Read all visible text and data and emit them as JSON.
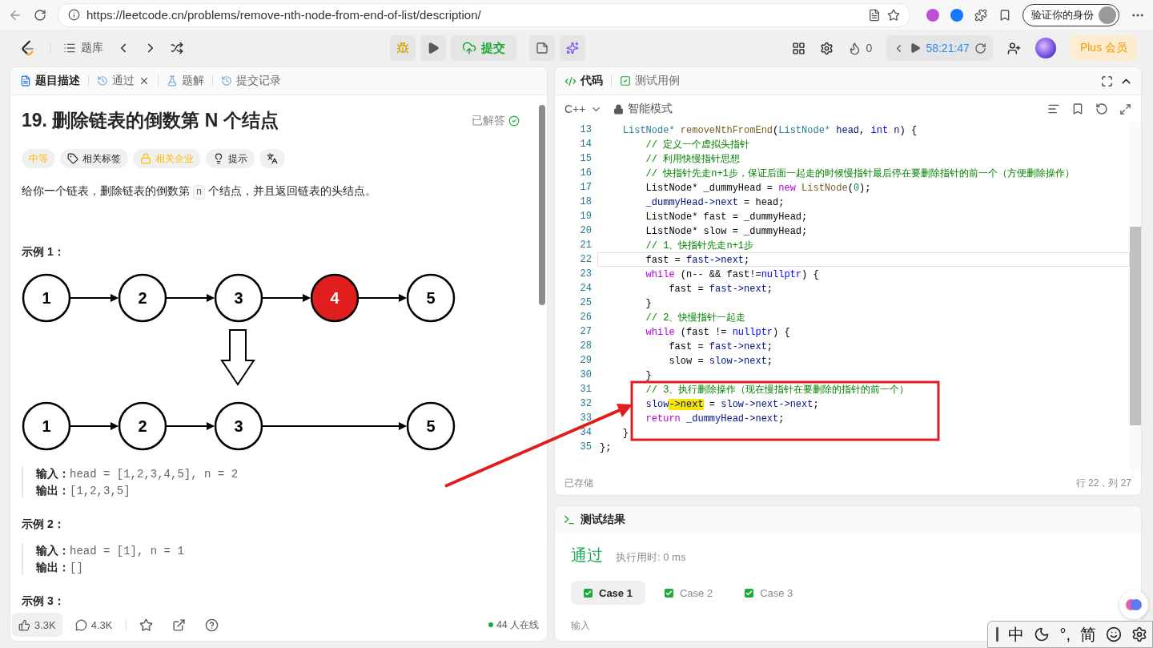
{
  "browser": {
    "url": "https://leetcode.cn/problems/remove-nth-node-from-end-of-list/description/",
    "profile_label": "验证你的身份"
  },
  "toolbar": {
    "problem_list": "题库",
    "submit": "提交",
    "streak": "0",
    "timer": "58:21:47",
    "plus": "Plus 会员"
  },
  "left_tabs": [
    {
      "label": "题目描述",
      "selected": true,
      "closable": false
    },
    {
      "label": "通过",
      "selected": false,
      "closable": true
    },
    {
      "label": "题解",
      "selected": false,
      "closable": false
    },
    {
      "label": "提交记录",
      "selected": false,
      "closable": false
    }
  ],
  "problem": {
    "title": "19. 删除链表的倒数第 N 个结点",
    "status": "已解答",
    "tags": [
      {
        "label": "中等",
        "kind": "difficulty"
      },
      {
        "label": "相关标签",
        "kind": "tag"
      },
      {
        "label": "相关企业",
        "kind": "company"
      },
      {
        "label": "提示",
        "kind": "hint"
      }
    ],
    "description": {
      "before": "给你一个链表，删除链表的倒数第 ",
      "code": "n",
      "after": " 个结点，并且返回链表的头结点。"
    },
    "examples": [
      {
        "title": "示例 1：",
        "diagram": {
          "before": [
            {
              "label": "1",
              "removed": false
            },
            {
              "label": "2",
              "removed": false
            },
            {
              "label": "3",
              "removed": false
            },
            {
              "label": "4",
              "removed": true
            },
            {
              "label": "5",
              "removed": false
            }
          ],
          "after": [
            {
              "label": "1"
            },
            {
              "label": "2"
            },
            {
              "label": "3"
            },
            {
              "label": "5"
            }
          ]
        },
        "lines": [
          {
            "label": "输入：",
            "value": "head = [1,2,3,4,5], n = 2"
          },
          {
            "label": "输出：",
            "value": "[1,2,3,5]"
          }
        ]
      },
      {
        "title": "示例 2：",
        "lines": [
          {
            "label": "输入：",
            "value": "head = [1], n = 1"
          },
          {
            "label": "输出：",
            "value": "[]"
          }
        ]
      },
      {
        "title": "示例 3："
      }
    ]
  },
  "left_footer": {
    "likes": "3.3K",
    "comments": "4.3K",
    "online": "44 人在线"
  },
  "right_tabs": [
    {
      "label": "代码",
      "selected": true
    },
    {
      "label": "测试用例",
      "selected": false
    }
  ],
  "editor": {
    "language": "C++",
    "mode": "智能模式",
    "saved": "已存储",
    "cursor": "行 22，列 27",
    "lines": [
      {
        "num": "13",
        "current": false,
        "tokens": [
          {
            "kind": "type",
            "text": "    ListNode*"
          },
          {
            "kind": "fn",
            "text": " removeNthFromEnd"
          },
          {
            "kind": "plain",
            "text": "("
          },
          {
            "kind": "type",
            "text": "ListNode*"
          },
          {
            "kind": "var",
            "text": " head"
          },
          {
            "kind": "plain",
            "text": ", "
          },
          {
            "kind": "kw2",
            "text": "int"
          },
          {
            "kind": "var",
            "text": " n"
          },
          {
            "kind": "plain",
            "text": ") {"
          }
        ]
      },
      {
        "num": "14",
        "current": false,
        "tokens": [
          {
            "kind": "comment",
            "text": "        // 定义一个虚拟头指针"
          }
        ]
      },
      {
        "num": "15",
        "current": false,
        "tokens": [
          {
            "kind": "comment",
            "text": "        // 利用快慢指针思想"
          }
        ]
      },
      {
        "num": "16",
        "current": false,
        "tokens": [
          {
            "kind": "comment",
            "text": "        // 快指针先走n+1步，保证后面一起走的时候慢指针最后停在要删除指针的前一个（方便删除操作）"
          }
        ]
      },
      {
        "num": "17",
        "current": false,
        "tokens": [
          {
            "kind": "plain",
            "text": "        ListNode* _dummyHead = "
          },
          {
            "kind": "kw",
            "text": "new"
          },
          {
            "kind": "fn",
            "text": " ListNode"
          },
          {
            "kind": "plain",
            "text": "("
          },
          {
            "kind": "num",
            "text": "0"
          },
          {
            "kind": "plain",
            "text": ");"
          }
        ]
      },
      {
        "num": "18",
        "current": false,
        "tokens": [
          {
            "kind": "var",
            "text": "        _dummyHead->next"
          },
          {
            "kind": "plain",
            "text": " = head;"
          }
        ]
      },
      {
        "num": "19",
        "current": false,
        "tokens": [
          {
            "kind": "plain",
            "text": "        ListNode* fast = _dummyHead;"
          }
        ]
      },
      {
        "num": "20",
        "current": false,
        "tokens": [
          {
            "kind": "plain",
            "text": "        ListNode* slow = _dummyHead;"
          }
        ]
      },
      {
        "num": "21",
        "current": false,
        "tokens": [
          {
            "kind": "comment",
            "text": "        // 1、快指针先走n+1步"
          }
        ]
      },
      {
        "num": "22",
        "current": true,
        "tokens": [
          {
            "kind": "plain",
            "text": "        fast = "
          },
          {
            "kind": "var",
            "text": "fast->next"
          },
          {
            "kind": "plain",
            "text": ";"
          }
        ]
      },
      {
        "num": "23",
        "current": false,
        "tokens": [
          {
            "kind": "kw",
            "text": "        while"
          },
          {
            "kind": "plain",
            "text": " (n-- && fast!="
          },
          {
            "kind": "kw2",
            "text": "nullptr"
          },
          {
            "kind": "plain",
            "text": ") {"
          }
        ]
      },
      {
        "num": "24",
        "current": false,
        "tokens": [
          {
            "kind": "plain",
            "text": "            fast = "
          },
          {
            "kind": "var",
            "text": "fast->next"
          },
          {
            "kind": "plain",
            "text": ";"
          }
        ]
      },
      {
        "num": "25",
        "current": false,
        "tokens": [
          {
            "kind": "plain",
            "text": "        }"
          }
        ]
      },
      {
        "num": "26",
        "current": false,
        "tokens": [
          {
            "kind": "comment",
            "text": "        // 2、快慢指针一起走"
          }
        ]
      },
      {
        "num": "27",
        "current": false,
        "tokens": [
          {
            "kind": "kw",
            "text": "        while"
          },
          {
            "kind": "plain",
            "text": " (fast != "
          },
          {
            "kind": "kw2",
            "text": "nullptr"
          },
          {
            "kind": "plain",
            "text": ") {"
          }
        ]
      },
      {
        "num": "28",
        "current": false,
        "tokens": [
          {
            "kind": "plain",
            "text": "            fast = "
          },
          {
            "kind": "var",
            "text": "fast->next"
          },
          {
            "kind": "plain",
            "text": ";"
          }
        ]
      },
      {
        "num": "29",
        "current": false,
        "tokens": [
          {
            "kind": "plain",
            "text": "            slow = "
          },
          {
            "kind": "var",
            "text": "slow->next"
          },
          {
            "kind": "plain",
            "text": ";"
          }
        ]
      },
      {
        "num": "30",
        "current": false,
        "tokens": [
          {
            "kind": "plain",
            "text": "        }"
          }
        ]
      },
      {
        "num": "31",
        "current": false,
        "tokens": [
          {
            "kind": "comment",
            "text": "        // 3、执行删除操作（现在慢指针在要删除的指针的前一个）"
          }
        ]
      },
      {
        "num": "32",
        "current": false,
        "tokens": [
          {
            "kind": "var",
            "text": "        slow"
          },
          {
            "kind": "match",
            "text": "->next"
          },
          {
            "kind": "plain",
            "text": " = "
          },
          {
            "kind": "var",
            "text": "slow->next->next"
          },
          {
            "kind": "plain",
            "text": ";"
          }
        ]
      },
      {
        "num": "33",
        "current": false,
        "tokens": [
          {
            "kind": "kw",
            "text": "        return"
          },
          {
            "kind": "var",
            "text": " _dummyHead->next"
          },
          {
            "kind": "plain",
            "text": ";"
          }
        ]
      },
      {
        "num": "34",
        "current": false,
        "tokens": [
          {
            "kind": "plain",
            "text": "    }"
          }
        ]
      },
      {
        "num": "35",
        "current": false,
        "tokens": [
          {
            "kind": "plain",
            "text": "};"
          }
        ]
      }
    ]
  },
  "results": {
    "title": "测试结果",
    "verdict": "通过",
    "runtime": "执行用时: 0 ms",
    "cases": [
      {
        "label": "Case 1",
        "selected": true
      },
      {
        "label": "Case 2",
        "selected": false
      },
      {
        "label": "Case 3",
        "selected": false
      }
    ],
    "input_label": "输入"
  },
  "ime": {
    "items": [
      {
        "kind": "text",
        "text": "中"
      },
      {
        "kind": "moon"
      },
      {
        "kind": "text",
        "text": "°,"
      },
      {
        "kind": "text",
        "text": "简"
      },
      {
        "kind": "smile"
      },
      {
        "kind": "gear"
      }
    ]
  }
}
